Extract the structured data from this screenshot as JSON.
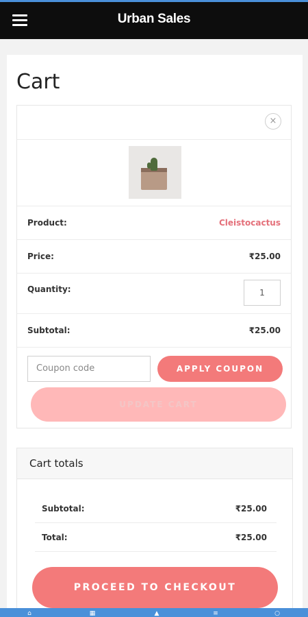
{
  "app": {
    "title": "Urban Sales",
    "menu_icon": "hamburger-menu-icon"
  },
  "page": {
    "title": "Cart"
  },
  "cart_item": {
    "remove_symbol": "×",
    "remove_icon": "close-icon",
    "product_label": "Product:",
    "product_name": "Cleistocactus",
    "price_label": "Price:",
    "price": "₹25.00",
    "quantity_label": "Quantity:",
    "quantity": "1",
    "subtotal_label": "Subtotal:",
    "subtotal": "₹25.00"
  },
  "coupon": {
    "placeholder": "Coupon code",
    "apply_label": "APPLY COUPON"
  },
  "update_cart_label": "UPDATE CART",
  "totals": {
    "title": "Cart totals",
    "subtotal_label": "Subtotal:",
    "subtotal": "₹25.00",
    "total_label": "Total:",
    "total": "₹25.00"
  },
  "checkout_label": "PROCEED TO CHECKOUT",
  "bottom_nav": {
    "items": [
      "home-icon",
      "calendar-icon",
      "share-icon",
      "list-icon",
      "search-icon"
    ]
  },
  "colors": {
    "accent": "#f37a7a",
    "accent_disabled": "#ffb8b8",
    "link": "#e4707a",
    "appbar": "#0d0d0d",
    "nav_bar": "#4a90d9"
  }
}
